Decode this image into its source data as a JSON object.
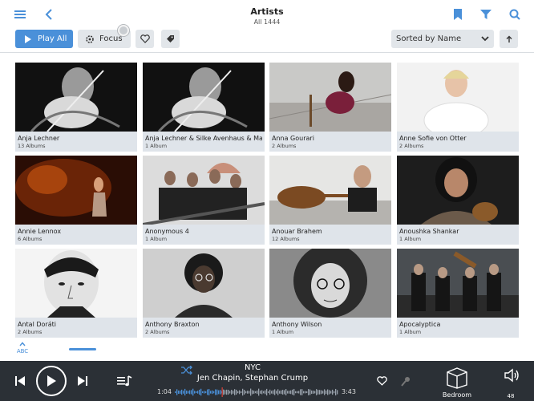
{
  "header": {
    "title": "Artists",
    "subtitle": "All 1444",
    "icons": [
      "hamburger-icon",
      "back-icon",
      "bookmark-icon",
      "filter-icon",
      "search-icon"
    ]
  },
  "toolbar": {
    "play_all_label": "Play All",
    "focus_label": "Focus",
    "sort_label": "Sorted by Name",
    "sort_direction_icon": "arrow-up-icon"
  },
  "artists": [
    {
      "name": "Anja Lechner",
      "count": "13 Albums"
    },
    {
      "name": "Anja Lechner & Silke Avenhaus & Maac",
      "count": "1 Album"
    },
    {
      "name": "Anna Gourari",
      "count": "2 Albums"
    },
    {
      "name": "Anne Sofie von Otter",
      "count": "2 Albums"
    },
    {
      "name": "Annie Lennox",
      "count": "6 Albums"
    },
    {
      "name": "Anonymous 4",
      "count": "1 Album"
    },
    {
      "name": "Anouar Brahem",
      "count": "12 Albums"
    },
    {
      "name": "Anoushka Shankar",
      "count": "1 Album"
    },
    {
      "name": "Antal Doráti",
      "count": "2 Albums"
    },
    {
      "name": "Anthony Braxton",
      "count": "2 Albums"
    },
    {
      "name": "Anthony Wilson",
      "count": "1 Album"
    },
    {
      "name": "Apocalyptica",
      "count": "1 Album"
    }
  ],
  "scroller": {
    "label": "ABC"
  },
  "player": {
    "track_title": "NYC",
    "track_artist": "Jen Chapin, Stephan Crump",
    "elapsed": "1:04",
    "duration": "3:43",
    "progress": 0.287,
    "zone": "Bedroom",
    "volume": "48"
  },
  "colors": {
    "accent": "#4a90d9",
    "player_bg": "#2b3036",
    "caption_bg": "#dfe4ea"
  }
}
